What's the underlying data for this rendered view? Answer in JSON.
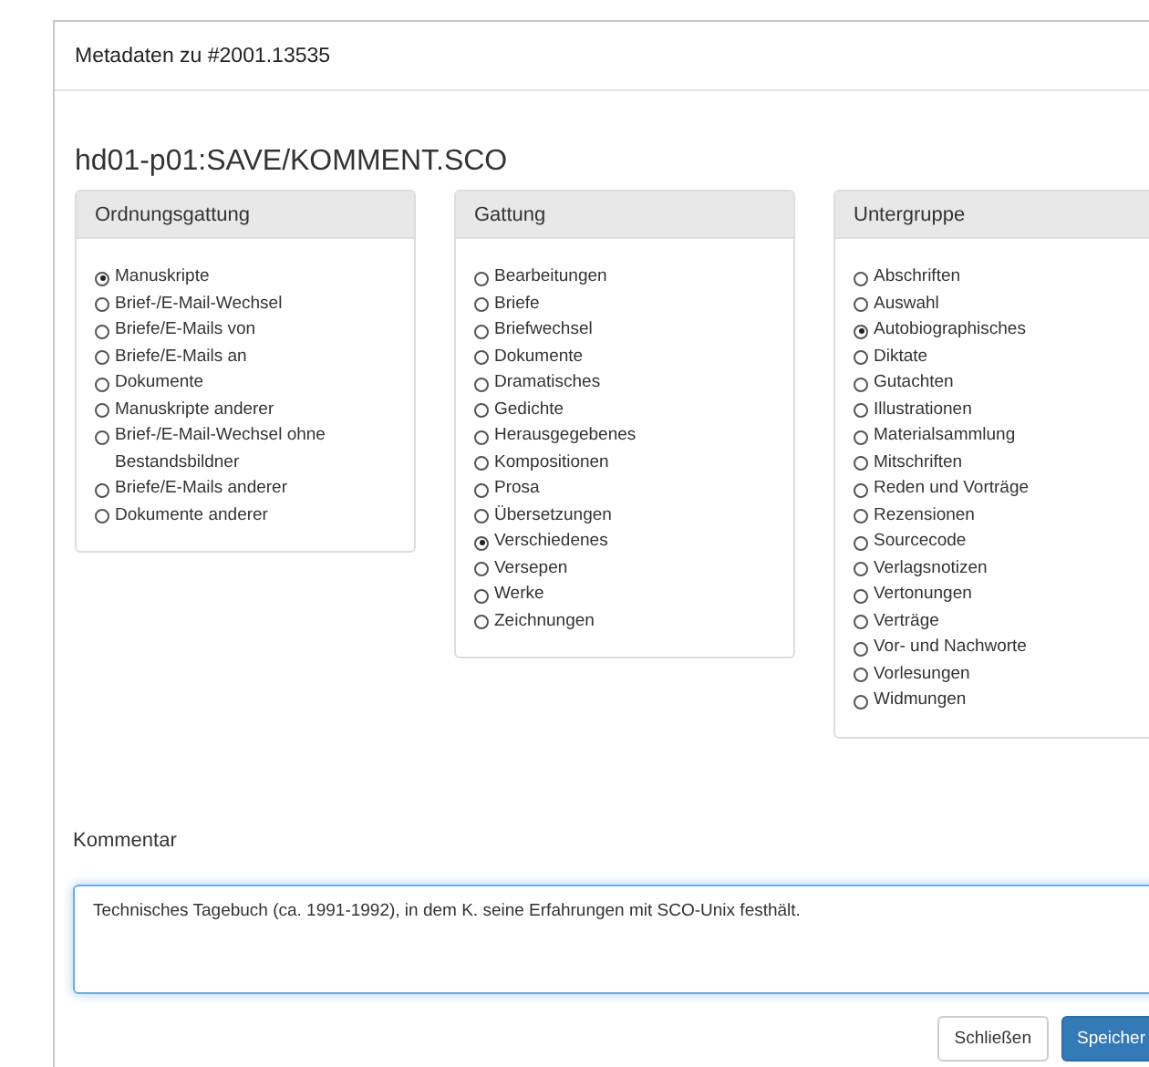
{
  "dialog": {
    "title": "Metadaten zu #2001.13535",
    "heading": "hd01-p01:SAVE/KOMMENT.SCO"
  },
  "panels": [
    {
      "title": "Ordnungsgattung",
      "options": [
        {
          "label": "Manuskripte",
          "selected": true
        },
        {
          "label": "Brief-/E-Mail-Wechsel",
          "selected": false
        },
        {
          "label": "Briefe/E-Mails von",
          "selected": false
        },
        {
          "label": "Briefe/E-Mails an",
          "selected": false
        },
        {
          "label": "Dokumente",
          "selected": false
        },
        {
          "label": "Manuskripte anderer",
          "selected": false
        },
        {
          "label": "Brief-/E-Mail-Wechsel ohne Bestandsbildner",
          "selected": false
        },
        {
          "label": "Briefe/E-Mails anderer",
          "selected": false
        },
        {
          "label": "Dokumente anderer",
          "selected": false
        }
      ]
    },
    {
      "title": "Gattung",
      "options": [
        {
          "label": "Bearbeitungen",
          "selected": false
        },
        {
          "label": "Briefe",
          "selected": false
        },
        {
          "label": "Briefwechsel",
          "selected": false
        },
        {
          "label": "Dokumente",
          "selected": false
        },
        {
          "label": "Dramatisches",
          "selected": false
        },
        {
          "label": "Gedichte",
          "selected": false
        },
        {
          "label": "Herausgegebenes",
          "selected": false
        },
        {
          "label": "Kompositionen",
          "selected": false
        },
        {
          "label": "Prosa",
          "selected": false
        },
        {
          "label": "Übersetzungen",
          "selected": false
        },
        {
          "label": "Verschiedenes",
          "selected": true
        },
        {
          "label": "Versepen",
          "selected": false
        },
        {
          "label": "Werke",
          "selected": false
        },
        {
          "label": "Zeichnungen",
          "selected": false
        }
      ]
    },
    {
      "title": "Untergruppe",
      "options": [
        {
          "label": "Abschriften",
          "selected": false
        },
        {
          "label": "Auswahl",
          "selected": false
        },
        {
          "label": "Autobiographisches",
          "selected": true
        },
        {
          "label": "Diktate",
          "selected": false
        },
        {
          "label": "Gutachten",
          "selected": false
        },
        {
          "label": "Illustrationen",
          "selected": false
        },
        {
          "label": "Materialsammlung",
          "selected": false
        },
        {
          "label": "Mitschriften",
          "selected": false
        },
        {
          "label": "Reden und Vorträge",
          "selected": false
        },
        {
          "label": "Rezensionen",
          "selected": false
        },
        {
          "label": "Sourcecode",
          "selected": false
        },
        {
          "label": "Verlagsnotizen",
          "selected": false
        },
        {
          "label": "Vertonungen",
          "selected": false
        },
        {
          "label": "Verträge",
          "selected": false
        },
        {
          "label": "Vor- und Nachworte",
          "selected": false
        },
        {
          "label": "Vorlesungen",
          "selected": false
        },
        {
          "label": "Widmungen",
          "selected": false
        }
      ]
    }
  ],
  "comment": {
    "label": "Kommentar",
    "value": "Technisches Tagebuch (ca. 1991-1992), in dem K. seine Erfahrungen mit SCO-Unix festhält."
  },
  "buttons": [
    {
      "label": "Schließen",
      "kind": "default"
    },
    {
      "label": "Speicher",
      "kind": "primary"
    }
  ]
}
